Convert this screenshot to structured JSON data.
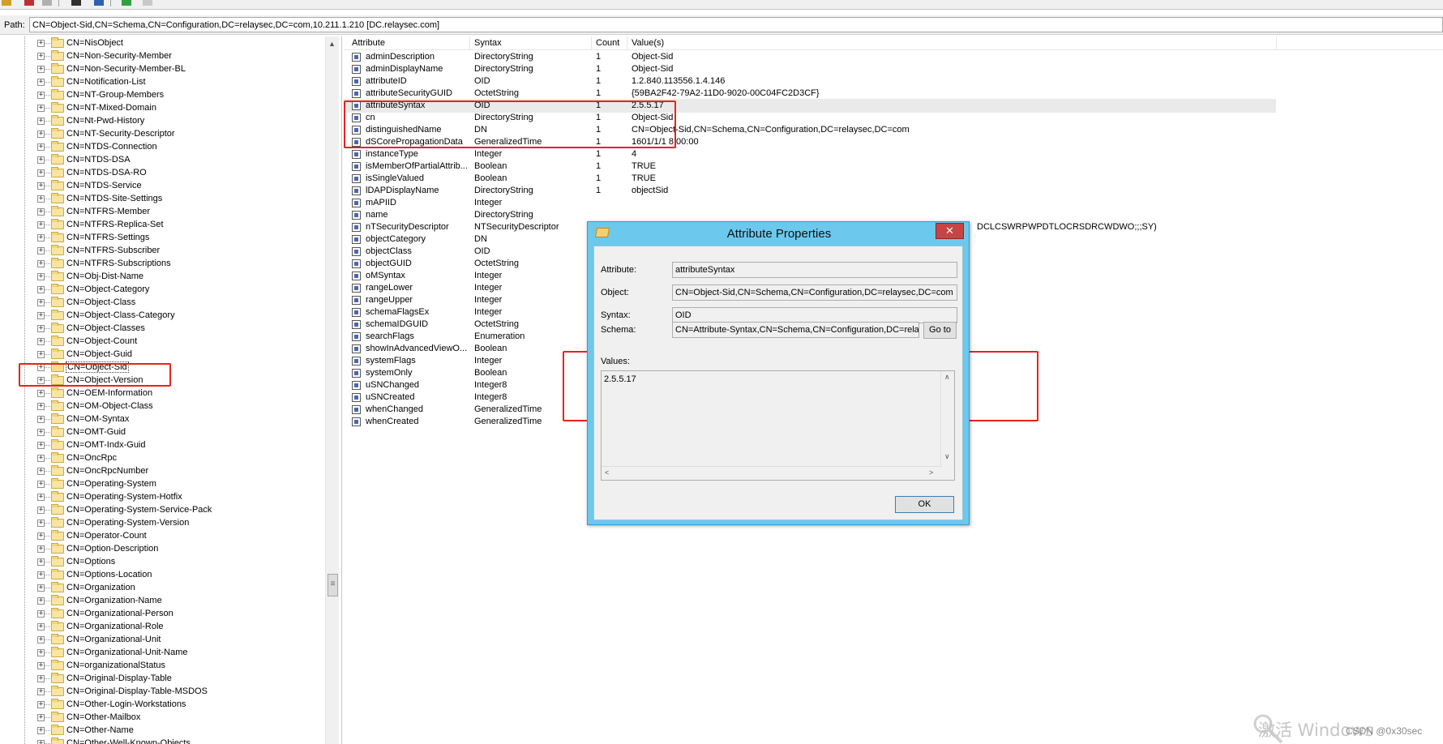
{
  "path": {
    "label": "Path:",
    "value": "CN=Object-Sid,CN=Schema,CN=Configuration,DC=relaysec,DC=com,10.211.1.210 [DC.relaysec.com]"
  },
  "tree": {
    "items": [
      {
        "label": "CN=NisObject"
      },
      {
        "label": "CN=Non-Security-Member"
      },
      {
        "label": "CN=Non-Security-Member-BL"
      },
      {
        "label": "CN=Notification-List"
      },
      {
        "label": "CN=NT-Group-Members"
      },
      {
        "label": "CN=NT-Mixed-Domain"
      },
      {
        "label": "CN=Nt-Pwd-History"
      },
      {
        "label": "CN=NT-Security-Descriptor"
      },
      {
        "label": "CN=NTDS-Connection"
      },
      {
        "label": "CN=NTDS-DSA"
      },
      {
        "label": "CN=NTDS-DSA-RO"
      },
      {
        "label": "CN=NTDS-Service"
      },
      {
        "label": "CN=NTDS-Site-Settings"
      },
      {
        "label": "CN=NTFRS-Member"
      },
      {
        "label": "CN=NTFRS-Replica-Set"
      },
      {
        "label": "CN=NTFRS-Settings"
      },
      {
        "label": "CN=NTFRS-Subscriber"
      },
      {
        "label": "CN=NTFRS-Subscriptions"
      },
      {
        "label": "CN=Obj-Dist-Name"
      },
      {
        "label": "CN=Object-Category"
      },
      {
        "label": "CN=Object-Class"
      },
      {
        "label": "CN=Object-Class-Category"
      },
      {
        "label": "CN=Object-Classes"
      },
      {
        "label": "CN=Object-Count"
      },
      {
        "label": "CN=Object-Guid"
      },
      {
        "label": "CN=Object-Sid"
      },
      {
        "label": "CN=Object-Version"
      },
      {
        "label": "CN=OEM-Information"
      },
      {
        "label": "CN=OM-Object-Class"
      },
      {
        "label": "CN=OM-Syntax"
      },
      {
        "label": "CN=OMT-Guid"
      },
      {
        "label": "CN=OMT-Indx-Guid"
      },
      {
        "label": "CN=OncRpc"
      },
      {
        "label": "CN=OncRpcNumber"
      },
      {
        "label": "CN=Operating-System"
      },
      {
        "label": "CN=Operating-System-Hotfix"
      },
      {
        "label": "CN=Operating-System-Service-Pack"
      },
      {
        "label": "CN=Operating-System-Version"
      },
      {
        "label": "CN=Operator-Count"
      },
      {
        "label": "CN=Option-Description"
      },
      {
        "label": "CN=Options"
      },
      {
        "label": "CN=Options-Location"
      },
      {
        "label": "CN=Organization"
      },
      {
        "label": "CN=Organization-Name"
      },
      {
        "label": "CN=Organizational-Person"
      },
      {
        "label": "CN=Organizational-Role"
      },
      {
        "label": "CN=Organizational-Unit"
      },
      {
        "label": "CN=Organizational-Unit-Name"
      },
      {
        "label": "CN=organizationalStatus"
      },
      {
        "label": "CN=Original-Display-Table"
      },
      {
        "label": "CN=Original-Display-Table-MSDOS"
      },
      {
        "label": "CN=Other-Login-Workstations"
      },
      {
        "label": "CN=Other-Mailbox"
      },
      {
        "label": "CN=Other-Name"
      },
      {
        "label": "CN=Other-Well-Known-Objects"
      }
    ],
    "selected": "CN=Object-Sid"
  },
  "list": {
    "headers": {
      "attribute": "Attribute",
      "syntax": "Syntax",
      "count": "Count",
      "values": "Value(s)"
    },
    "rows": [
      {
        "attribute": "adminDescription",
        "syntax": "DirectoryString",
        "count": "1",
        "value": "Object-Sid"
      },
      {
        "attribute": "adminDisplayName",
        "syntax": "DirectoryString",
        "count": "1",
        "value": "Object-Sid"
      },
      {
        "attribute": "attributeID",
        "syntax": "OID",
        "count": "1",
        "value": "1.2.840.113556.1.4.146"
      },
      {
        "attribute": "attributeSecurityGUID",
        "syntax": "OctetString",
        "count": "1",
        "value": "{59BA2F42-79A2-11D0-9020-00C04FC2D3CF}"
      },
      {
        "attribute": "attributeSyntax",
        "syntax": "OID",
        "count": "1",
        "value": "2.5.5.17"
      },
      {
        "attribute": "cn",
        "syntax": "DirectoryString",
        "count": "1",
        "value": "Object-Sid"
      },
      {
        "attribute": "distinguishedName",
        "syntax": "DN",
        "count": "1",
        "value": "CN=Object-Sid,CN=Schema,CN=Configuration,DC=relaysec,DC=com"
      },
      {
        "attribute": "dSCorePropagationData",
        "syntax": "GeneralizedTime",
        "count": "1",
        "value": "1601/1/1 8:00:00"
      },
      {
        "attribute": "instanceType",
        "syntax": "Integer",
        "count": "1",
        "value": "4"
      },
      {
        "attribute": "isMemberOfPartialAttrib...",
        "syntax": "Boolean",
        "count": "1",
        "value": "TRUE"
      },
      {
        "attribute": "isSingleValued",
        "syntax": "Boolean",
        "count": "1",
        "value": "TRUE"
      },
      {
        "attribute": "lDAPDisplayName",
        "syntax": "DirectoryString",
        "count": "1",
        "value": "objectSid"
      },
      {
        "attribute": "mAPIID",
        "syntax": "Integer",
        "count": "",
        "value": ""
      },
      {
        "attribute": "name",
        "syntax": "DirectoryString",
        "count": "",
        "value": ""
      },
      {
        "attribute": "nTSecurityDescriptor",
        "syntax": "NTSecurityDescriptor",
        "count": "",
        "value": "DCLCSWRPWPDTLOCRSDRCWDWO;;;SY)"
      },
      {
        "attribute": "objectCategory",
        "syntax": "DN",
        "count": "",
        "value": ""
      },
      {
        "attribute": "objectClass",
        "syntax": "OID",
        "count": "",
        "value": ""
      },
      {
        "attribute": "objectGUID",
        "syntax": "OctetString",
        "count": "",
        "value": ""
      },
      {
        "attribute": "oMSyntax",
        "syntax": "Integer",
        "count": "",
        "value": ""
      },
      {
        "attribute": "rangeLower",
        "syntax": "Integer",
        "count": "",
        "value": ""
      },
      {
        "attribute": "rangeUpper",
        "syntax": "Integer",
        "count": "",
        "value": ""
      },
      {
        "attribute": "schemaFlagsEx",
        "syntax": "Integer",
        "count": "",
        "value": ""
      },
      {
        "attribute": "schemaIDGUID",
        "syntax": "OctetString",
        "count": "",
        "value": ""
      },
      {
        "attribute": "searchFlags",
        "syntax": "Enumeration",
        "count": "",
        "value": ""
      },
      {
        "attribute": "showInAdvancedViewO...",
        "syntax": "Boolean",
        "count": "",
        "value": ""
      },
      {
        "attribute": "systemFlags",
        "syntax": "Integer",
        "count": "",
        "value": ""
      },
      {
        "attribute": "systemOnly",
        "syntax": "Boolean",
        "count": "",
        "value": ""
      },
      {
        "attribute": "uSNChanged",
        "syntax": "Integer8",
        "count": "",
        "value": ""
      },
      {
        "attribute": "uSNCreated",
        "syntax": "Integer8",
        "count": "",
        "value": ""
      },
      {
        "attribute": "whenChanged",
        "syntax": "GeneralizedTime",
        "count": "",
        "value": ""
      },
      {
        "attribute": "whenCreated",
        "syntax": "GeneralizedTime",
        "count": "",
        "value": ""
      }
    ],
    "highlighted": "attributeSyntax"
  },
  "dialog": {
    "title": "Attribute Properties",
    "close_label": "✕",
    "attribute_label": "Attribute:",
    "attribute_value": "attributeSyntax",
    "object_label": "Object:",
    "object_value": "CN=Object-Sid,CN=Schema,CN=Configuration,DC=relaysec,DC=com",
    "syntax_label": "Syntax:",
    "syntax_value": "OID",
    "schema_label": "Schema:",
    "schema_value": "CN=Attribute-Syntax,CN=Schema,CN=Configuration,DC=relayse",
    "goto_label": "Go to",
    "values_label": "Values:",
    "values_text": "2.5.5.17",
    "ok_label": "OK"
  },
  "watermark": {
    "text": "激活 Windows",
    "credit": "CSDN @0x30sec"
  },
  "colors": {
    "annotation_red": "#e8221e",
    "dialog_frame": "#6cc8ec",
    "close_button": "#c74444"
  }
}
